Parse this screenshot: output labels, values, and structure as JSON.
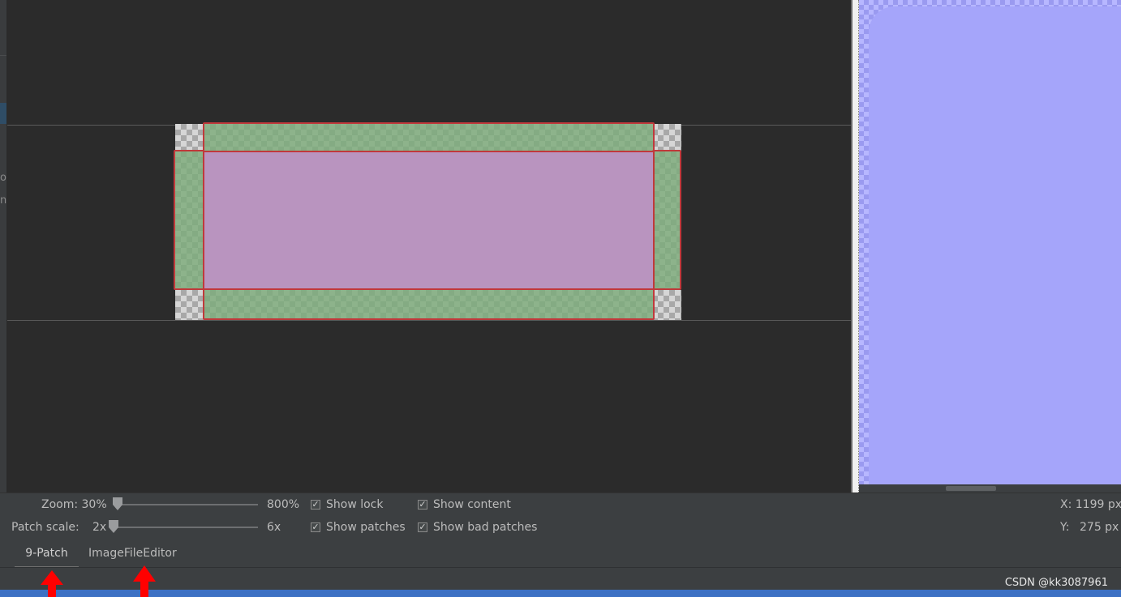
{
  "left_edge": {
    "text_a": "oi",
    "text_b": "n"
  },
  "controls": {
    "zoom_label": "Zoom: 30%",
    "zoom_max": "800%",
    "patch_scale_label": "Patch scale:",
    "patch_scale_min": "2x",
    "patch_scale_max": "6x",
    "zoom_level": 0.0,
    "patch_scale_level": 0.0,
    "checkboxes": [
      {
        "label": "Show lock",
        "checked": true
      },
      {
        "label": "Show content",
        "checked": true
      },
      {
        "label": "Show patches",
        "checked": true
      },
      {
        "label": "Show bad patches",
        "checked": true
      }
    ],
    "coord_x": "X: 1199 px",
    "coord_y_label": "Y:",
    "coord_y_value": "275 px"
  },
  "tabs": [
    {
      "label": "9-Patch",
      "active": true
    },
    {
      "label": "ImageFileEditor",
      "active": false
    }
  ],
  "watermark": "CSDN @kk3087961",
  "colors": {
    "patch_green": "#8db38b",
    "content_pink": "#b994bf",
    "bad_patch_red": "#c0393b",
    "preview_blue": "#a5a5fa",
    "annotation_arrow": "#ff0000",
    "status_blue": "#3d71c4"
  },
  "icons": {
    "slider_knob": "slider-knob-icon",
    "checkbox": "checkmark-icon",
    "annotation": "red-arrow-icon"
  }
}
